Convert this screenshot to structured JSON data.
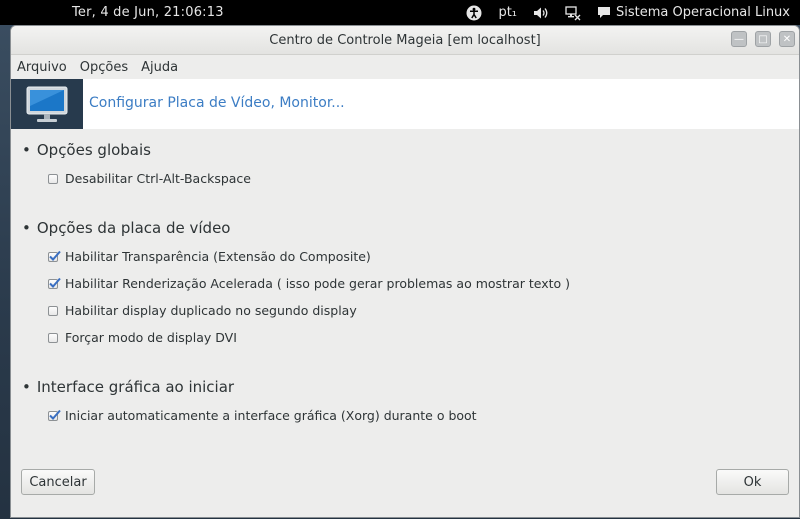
{
  "panel": {
    "clock": "Ter,  4 de Jun, 21:06:13",
    "keyboard_layout": "pt₁",
    "user": "Sistema Operacional Linux"
  },
  "window": {
    "title": "Centro de Controle Mageia  [em localhost]"
  },
  "menubar": {
    "items": [
      "Arquivo",
      "Opções",
      "Ajuda"
    ]
  },
  "banner": {
    "title": "Configurar Placa de Vídeo, Monitor..."
  },
  "sections": [
    {
      "title": "Opções globais",
      "options": [
        {
          "label": "Desabilitar Ctrl-Alt-Backspace",
          "checked": false
        }
      ]
    },
    {
      "title": "Opções da placa de vídeo",
      "options": [
        {
          "label": "Habilitar Transparência (Extensão do Composite)",
          "checked": true
        },
        {
          "label": "Habilitar Renderização Acelerada ( isso pode gerar problemas ao mostrar texto )",
          "checked": true
        },
        {
          "label": "Habilitar display duplicado no segundo display",
          "checked": false
        },
        {
          "label": "Forçar modo de display DVI",
          "checked": false
        }
      ]
    },
    {
      "title": "Interface gráfica ao iniciar",
      "options": [
        {
          "label": "Iniciar automaticamente a interface gráfica (Xorg) durante o boot",
          "checked": true
        }
      ]
    }
  ],
  "buttons": {
    "cancel": "Cancelar",
    "ok": "Ok"
  },
  "colors": {
    "accent": "#3c7dc4",
    "check": "#3a6fc2"
  }
}
